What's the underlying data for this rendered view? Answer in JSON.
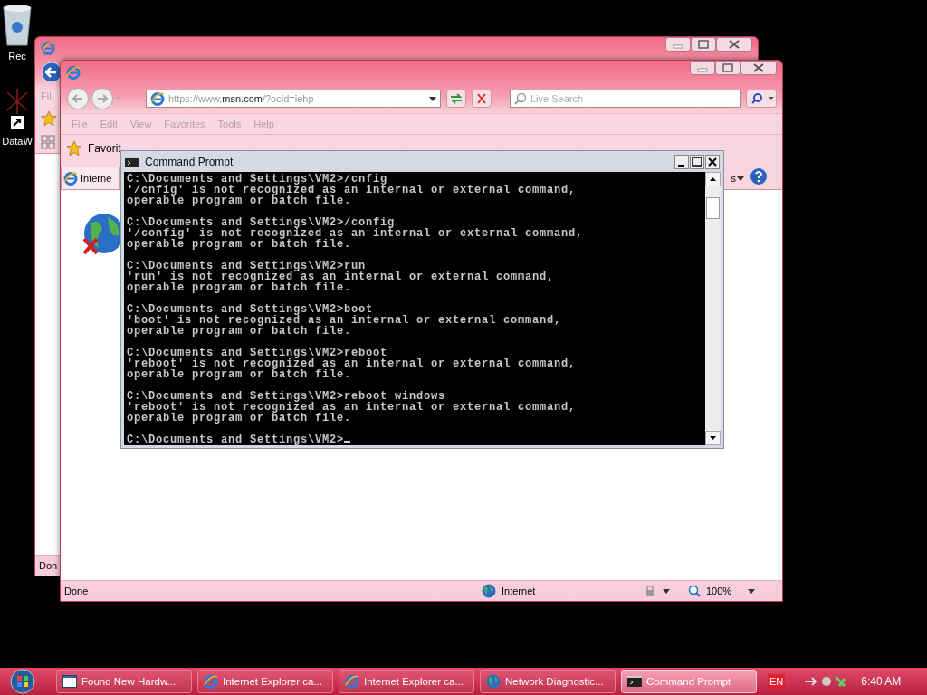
{
  "desktop_icons": [
    {
      "kind": "recycle",
      "label": "Rec"
    },
    {
      "kind": "shortcut",
      "label": "DataW"
    }
  ],
  "back_window": {
    "menu_label": "Fil",
    "status": "Don"
  },
  "browser": {
    "address": "https://www.**msn.com**/?ocid=iehp",
    "search_placeholder": "Live Search",
    "menu": [
      "File",
      "Edit",
      "View",
      "Favorites",
      "Tools",
      "Help"
    ],
    "favorites_label": "Favorit",
    "tab_label": "Interne",
    "tools_label": "s",
    "status": "Done",
    "zone": "Internet",
    "zoom": "100%"
  },
  "console": {
    "title": "Command Prompt",
    "blocks": [
      [
        "C:\\Documents and Settings\\VM2>/cnfig",
        "'/cnfig' is not recognized as an internal or external command,",
        "operable program or batch file."
      ],
      [
        "C:\\Documents and Settings\\VM2>/config",
        "'/config' is not recognized as an internal or external command,",
        "operable program or batch file."
      ],
      [
        "C:\\Documents and Settings\\VM2>run",
        "'run' is not recognized as an internal or external command,",
        "operable program or batch file."
      ],
      [
        "C:\\Documents and Settings\\VM2>boot",
        "'boot' is not recognized as an internal or external command,",
        "operable program or batch file."
      ],
      [
        "C:\\Documents and Settings\\VM2>reboot",
        "'reboot' is not recognized as an internal or external command,",
        "operable program or batch file."
      ],
      [
        "C:\\Documents and Settings\\VM2>reboot windows",
        "'reboot' is not recognized as an internal or external command,",
        "operable program or batch file."
      ],
      [
        "C:\\Documents and Settings\\VM2>"
      ]
    ]
  },
  "taskbar": {
    "buttons": [
      {
        "kind": "window",
        "label": "Found New Hardw...",
        "selected": false
      },
      {
        "kind": "ie",
        "label": "Internet Explorer ca...",
        "selected": false
      },
      {
        "kind": "ie",
        "label": "Internet Explorer ca...",
        "selected": false
      },
      {
        "kind": "network",
        "label": "Network Diagnostic...",
        "selected": false
      },
      {
        "kind": "console",
        "label": "Command Prompt",
        "selected": true
      }
    ],
    "language": "EN",
    "clock": "6:40 AM"
  }
}
